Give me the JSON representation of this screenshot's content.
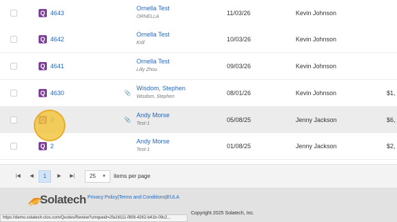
{
  "rows": [
    {
      "quote_icon": "Q",
      "number": "4643",
      "customer": "Ornella Test",
      "contact": "ORNELLA",
      "attachment": false,
      "date": "11/03/26",
      "rep": "Kevin Johnson",
      "amount": ""
    },
    {
      "quote_icon": "Q",
      "number": "4642",
      "customer": "Ornella Test",
      "contact": "Krill",
      "attachment": false,
      "date": "10/03/26",
      "rep": "Kevin Johnson",
      "amount": ""
    },
    {
      "quote_icon": "Q",
      "number": "4641",
      "customer": "Ornella Test",
      "contact": "Lilly Zhou",
      "attachment": false,
      "date": "09/03/26",
      "rep": "Kevin Johnson",
      "amount": ""
    },
    {
      "quote_icon": "Q",
      "number": "4630",
      "customer": "Wisdom, Stephen",
      "contact": "Wisdom, Stephen",
      "attachment": true,
      "date": "08/01/26",
      "rep": "Kevin Johnson",
      "amount": "$1,"
    },
    {
      "quote_icon": "Q",
      "number": "3",
      "customer": "Andy Morse",
      "contact": "Test-1",
      "attachment": true,
      "date": "05/08/25",
      "rep": "Jenny Jackson",
      "amount": "$6,"
    },
    {
      "quote_icon": "Q",
      "number": "2",
      "customer": "Andy Morse",
      "contact": "Test-1",
      "attachment": false,
      "date": "01/08/25",
      "rep": "Jenny Jackson",
      "amount": "$2,"
    }
  ],
  "pager": {
    "first_icon": "first-page-icon",
    "prev_icon": "prev-page-icon",
    "current_page": "1",
    "next_icon": "next-page-icon",
    "last_icon": "last-page-icon",
    "page_size": "25",
    "items_per_page_label": "items per page"
  },
  "footer": {
    "logo_text": "Solatech",
    "links": [
      "Privacy Policy",
      "Terms and Conditions",
      "EULA"
    ],
    "separator": "|",
    "copyright": "Copyright 2025 Solatech, Inc.",
    "status_url": "https://demo.solatech-clos.com/Quotes/Review?umqueid=2fa16111-f808-4262-b41b-09c2..."
  },
  "colors": {
    "accent": "#1f66c1",
    "quote_badge": "#7e3f98",
    "highlight": "#f3c43a"
  }
}
